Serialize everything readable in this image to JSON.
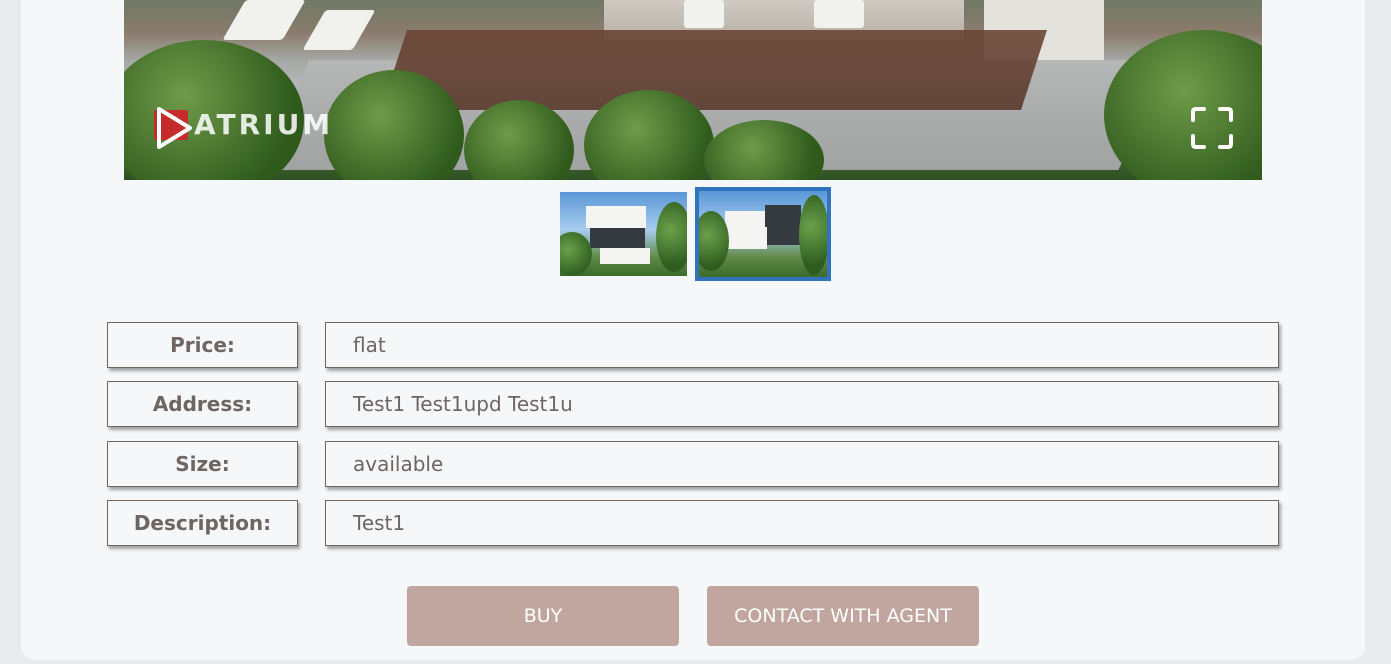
{
  "gallery": {
    "logo_text": "ATRIUM",
    "play_icon": "play-icon",
    "fullscreen_icon": "fullscreen-icon",
    "selected_thumbnail": 2,
    "thumbnail_count": 2,
    "accent_color": "#2f74bd"
  },
  "details": [
    {
      "label": "Price:",
      "value": "flat"
    },
    {
      "label": "Address:",
      "value": "Test1 Test1upd Test1u"
    },
    {
      "label": "Size:",
      "value": "available"
    },
    {
      "label": "Description:",
      "value": "Test1"
    }
  ],
  "actions": {
    "buy_label": "BUY",
    "contact_label": "CONTACT WITH AGENT",
    "button_color": "#c1a69f"
  }
}
